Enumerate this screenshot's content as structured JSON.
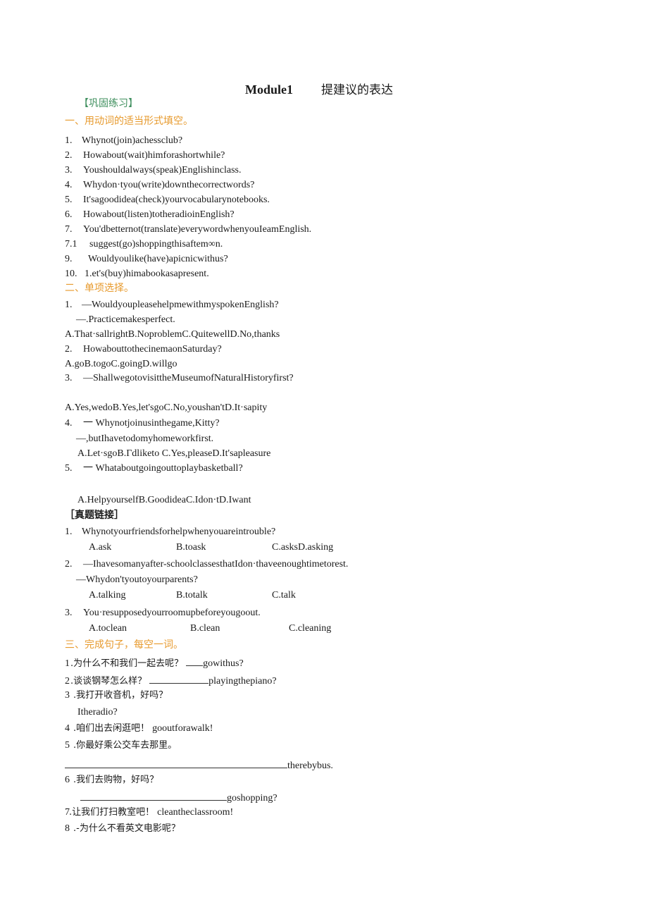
{
  "title": {
    "module": "Module1",
    "topic": "提建议的表达"
  },
  "section_practice": "【巩固练习】",
  "part1": {
    "heading": "一、用动词的适当形式填空。",
    "items": [
      {
        "n": "1.",
        "text": "Whynot(join)achessclub?"
      },
      {
        "n": "2.",
        "text": "Howabout(wait)himforashortwhile?"
      },
      {
        "n": "3.",
        "text": "Youshouldalways(speak)Englishinclass."
      },
      {
        "n": "4.",
        "text": "Whydon·tyou(write)downthecorrectwords?"
      },
      {
        "n": "5.",
        "text": "It'sagoodidea(check)yourvocabularynotebooks."
      },
      {
        "n": "6.",
        "text": "Howabout(listen)totheradioinEnglish?"
      },
      {
        "n": "7.",
        "text": "You'dbetternot(translate)everywordwhenyouIeamEnglish."
      },
      {
        "n": "7.1",
        "text": "suggest(go)shoppingthisaftem∞n."
      },
      {
        "n": "9.",
        "text": "Wouldyoulike(have)apicnicwithus?"
      },
      {
        "n": "10.",
        "text": "1.et's(buy)himabookasapresent."
      }
    ]
  },
  "part2": {
    "heading": "二、单项选择。",
    "q1": {
      "n": "1.",
      "text": "—WouldyoupleasehelpmewithmyspokenEnglish?",
      "reply": "—.Practicemakesperfect.",
      "options": "A.That·sallrightB.NoproblemC.QuitewellD.No,thanks"
    },
    "q2": {
      "n": "2.",
      "text": "HowabouttothecinemaonSaturday?",
      "options": "A.goB.togoC.goingD.willgo"
    },
    "q3": {
      "n": "3.",
      "text": "—ShallwegotovisittheMuseumofNaturalHistoryfirst?",
      "options": "A.Yes,wedoB.Yes,let'sgoC.No,youshan'tD.It·sapity"
    },
    "q4": {
      "n": "4.",
      "text": "一 Whynotjoinusinthegame,Kitty?",
      "reply": "—,butIhavetodomyhomeworkfirst.",
      "options": "A.Let·sgoB.Γdliketo C.Yes,pleaseD.It'sapleasure"
    },
    "q5": {
      "n": "5.",
      "text": "一 Whataboutgoingouttoplaybasketball?",
      "options": "A.HelpyourselfB.GoodideaC.Idon·tD.Iwant"
    }
  },
  "real_exam": {
    "heading": "［真题链接］",
    "q1": {
      "n": "1.",
      "text": "Whynotyourfriendsforhelpwhenyouareintrouble?",
      "options": [
        "A.ask",
        "B.toask",
        "C.asksD.asking"
      ]
    },
    "q2": {
      "n": "2.",
      "text": "—Ihavesomanyafter-schoolclassesthatIdon·thaveenoughtimetorest.",
      "reply": "—Whydon'tyoutoyourparents?",
      "options": [
        "A.talking",
        "B.totalk",
        "C.talk"
      ]
    },
    "q3": {
      "n": "3.",
      "text": "You·resupposedyourroomupbeforeyougoout.",
      "options": [
        "A.toclean",
        "B.clean",
        "C.cleaning"
      ]
    }
  },
  "part3": {
    "heading": "三、完成句子，每空一词。",
    "items": [
      {
        "n": "1",
        "cn": ".为什么不和我们一起去呢？",
        "en": "gowithus?"
      },
      {
        "n": "2",
        "cn": ".谈谈钢琴怎么样？",
        "en": "playingthepiano?"
      },
      {
        "n": "3",
        "cn": ".我打开收音机，好吗？",
        "en": "Itheradio?"
      },
      {
        "n": "4",
        "cn": ".咱们出去闲逛吧！",
        "en": "gooutforawalk!"
      },
      {
        "n": "5",
        "cn": ".你最好乘公交车去那里。",
        "en": "therebybus."
      },
      {
        "n": "6",
        "cn": ".我们去购物，好吗？",
        "en": "goshopping?"
      },
      {
        "n": "7",
        "cn": ".让我们打扫教室吧！",
        "en": "cleantheclassroom!"
      },
      {
        "n": "8",
        "cn": ".-为什么不看英文电影呢？",
        "en": ""
      }
    ]
  }
}
